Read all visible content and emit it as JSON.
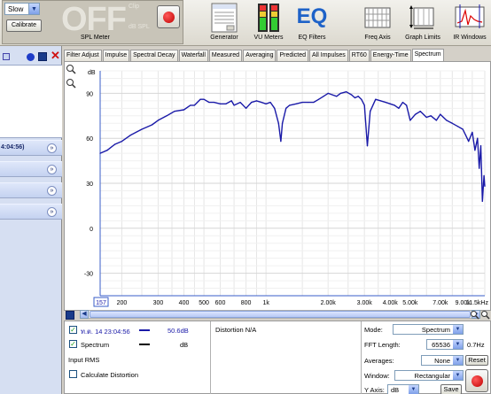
{
  "toolbar": {
    "level_combo_value": "Slow",
    "calibrate_label": "Calibrate",
    "spl_display": "OFF",
    "clip_label": "Clip",
    "dbspl_label": "dB SPL",
    "spl_meter_label": "SPL Meter",
    "tools": [
      {
        "label": "Generator",
        "icon": "generator-icon"
      },
      {
        "label": "VU Meters",
        "icon": "vu-meters-icon"
      },
      {
        "label": "EQ Filters",
        "icon": "eq-filters-icon"
      },
      {
        "label": "Freq Axis",
        "icon": "freq-axis-icon"
      },
      {
        "label": "Graph Limits",
        "icon": "graph-limits-icon"
      },
      {
        "label": "IR Windows",
        "icon": "ir-windows-icon"
      }
    ],
    "eq_logo": "EQ"
  },
  "left_panel": {
    "rows": [
      {
        "label": "4:04:56)"
      },
      {
        "label": ""
      },
      {
        "label": ""
      },
      {
        "label": ""
      }
    ]
  },
  "tabs": [
    "Filter Adjust",
    "Impulse",
    "Spectral Decay",
    "Waterfall",
    "Measured",
    "Averaging",
    "Predicted",
    "All Impulses",
    "RT60",
    "Energy-Time",
    "Spectrum"
  ],
  "active_tab": "Spectrum",
  "graph": {
    "y_unit": "dB",
    "x_start_box": "157"
  },
  "chart_data": {
    "type": "line",
    "ylabel": "dB",
    "xlabel": "",
    "x_scale": "log",
    "ylim": [
      -45,
      105
    ],
    "xlim": [
      157,
      11500
    ],
    "y_ticks": [
      90,
      60,
      30,
      0,
      -30
    ],
    "x_tick_labels": [
      "157",
      "200",
      "300",
      "400",
      "500",
      "600",
      "800",
      "1k",
      "2.00k",
      "3.00k",
      "4.00k",
      "5.00k",
      "7.00k",
      "9.00k",
      "11.5kHz"
    ],
    "grid": true,
    "series": [
      {
        "name": "Spectrum",
        "color": "#1a1aa8",
        "x": [
          157,
          170,
          185,
          200,
          220,
          250,
          280,
          300,
          330,
          360,
          400,
          430,
          450,
          480,
          500,
          530,
          560,
          600,
          640,
          680,
          700,
          750,
          800,
          850,
          900,
          950,
          1000,
          1050,
          1100,
          1150,
          1180,
          1200,
          1250,
          1300,
          1400,
          1500,
          1600,
          1700,
          1800,
          1900,
          2000,
          2100,
          2200,
          2300,
          2450,
          2600,
          2700,
          2800,
          2900,
          3000,
          3100,
          3200,
          3400,
          3600,
          3800,
          4000,
          4200,
          4400,
          4600,
          4800,
          5000,
          5300,
          5600,
          6000,
          6300,
          6700,
          7000,
          7500,
          8000,
          8500,
          9000,
          9300,
          9600,
          10000,
          10300,
          10600,
          10800,
          11000,
          11200,
          11400,
          11500
        ],
        "y": [
          50,
          52,
          56,
          58,
          62,
          66,
          69,
          72,
          75,
          78,
          79,
          82,
          82,
          86,
          86,
          84,
          84,
          83,
          83,
          85,
          82,
          84,
          80,
          84,
          85,
          84,
          83,
          84,
          80,
          70,
          58,
          70,
          80,
          82,
          83,
          84,
          84,
          84,
          86,
          88,
          90,
          89,
          88,
          90,
          91,
          89,
          87,
          88,
          86,
          82,
          55,
          78,
          86,
          85,
          84,
          83,
          82,
          80,
          84,
          82,
          72,
          76,
          78,
          74,
          75,
          72,
          76,
          72,
          70,
          68,
          66,
          62,
          58,
          64,
          52,
          60,
          40,
          55,
          18,
          35,
          28
        ]
      }
    ]
  },
  "bottom": {
    "legend": [
      {
        "label": "ท.ต. 14 23:04:56",
        "value": "50.6dB",
        "checked": true,
        "color": "#1a1aa8"
      },
      {
        "label": "Spectrum",
        "value": "dB",
        "checked": true,
        "color": "#000000"
      }
    ],
    "input_rms_label": "Input RMS",
    "calc_distortion_label": "Calculate Distortion",
    "distortion_label": "Distortion N/A",
    "mode_label": "Mode:",
    "mode_value": "Spectrum",
    "fft_label": "FFT Length:",
    "fft_value": "65536",
    "fft_res": "0.7Hz",
    "averages_label": "Averages:",
    "averages_value": "None",
    "reset_label": "Reset",
    "window_label": "Window:",
    "window_value": "Rectangular",
    "yaxis_label": "Y Axis:",
    "yaxis_value": "dB",
    "save_label": "Save"
  }
}
